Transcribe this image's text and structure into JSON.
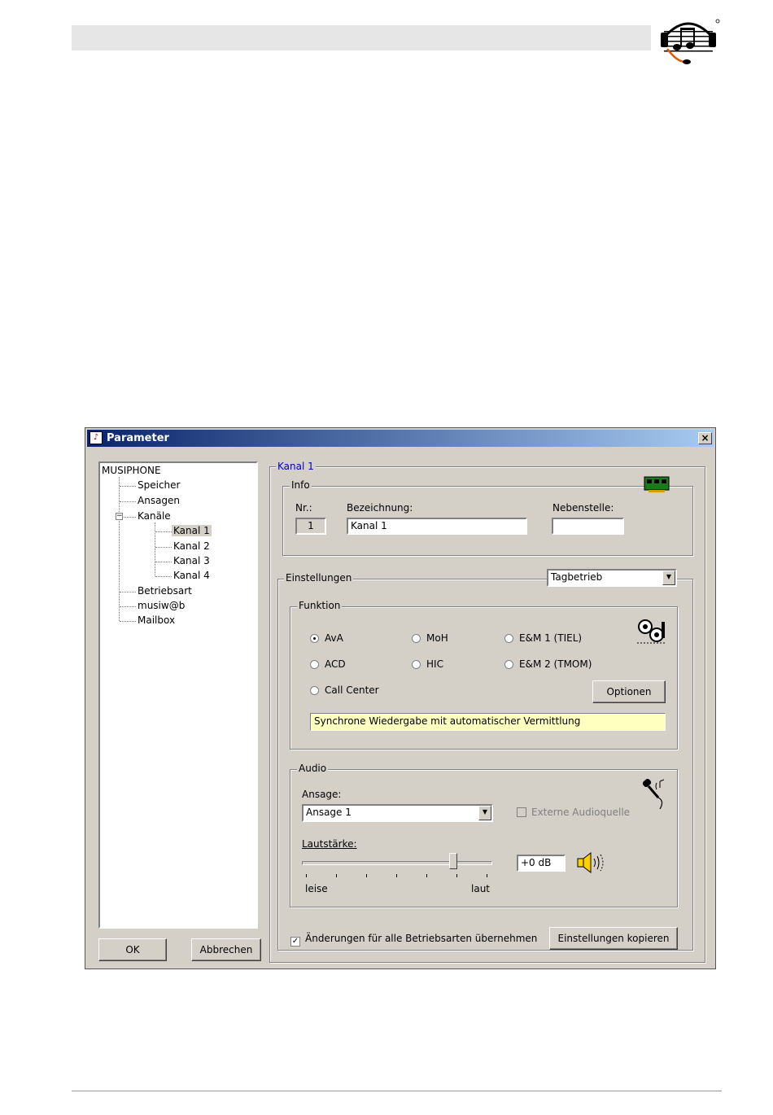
{
  "page": {
    "header_bar": "",
    "logo_icon": "music-notes-headset-logo"
  },
  "dialog": {
    "title": "Parameter",
    "close_label": "×",
    "tree": {
      "root": "MUSIPHONE",
      "items": {
        "speicher": "Speicher",
        "ansagen": "Ansagen",
        "kanaele": "Kanäle",
        "kanal1": "Kanal 1",
        "kanal2": "Kanal 2",
        "kanal3": "Kanal 3",
        "kanal4": "Kanal 4",
        "betriebsart": "Betriebsart",
        "musiwb": "musiw@b",
        "mailbox": "Mailbox"
      }
    },
    "buttons": {
      "ok": "OK",
      "abbrechen": "Abbrechen"
    },
    "panel": {
      "title": "Kanal 1",
      "info": {
        "label": "Info",
        "nr_label": "Nr.:",
        "nr_value": "1",
        "bezeichnung_label": "Bezeichnung:",
        "bezeichnung_value": "Kanal 1",
        "nebenstelle_label": "Nebenstelle:",
        "nebenstelle_value": ""
      },
      "einstellungen": {
        "label": "Einstellungen",
        "mode_selected": "Tagbetrieb",
        "funktion": {
          "label": "Funktion",
          "options": {
            "ava": "AvA",
            "moh": "MoH",
            "em1": "E&M 1  (TIEL)",
            "acd": "ACD",
            "hic": "HIC",
            "em2": "E&M 2  (TMOM)",
            "callcenter": "Call Center"
          },
          "selected": "AvA",
          "optionen_button": "Optionen",
          "description": "Synchrone Wiedergabe mit automatischer Vermittlung"
        },
        "audio": {
          "label": "Audio",
          "ansage_label": "Ansage:",
          "ansage_value": "Ansage 1",
          "externe_label": "Externe Audioquelle",
          "lautstaerke_label": "Lautstärke:",
          "slider_min_label": "leise",
          "slider_max_label": "laut",
          "volume_level": 0.8,
          "db_value": "+0 dB"
        },
        "alle_checkbox_label": "Änderungen für alle Betriebsarten übernehmen",
        "alle_checked": true,
        "kopieren_button": "Einstellungen kopieren"
      }
    }
  }
}
